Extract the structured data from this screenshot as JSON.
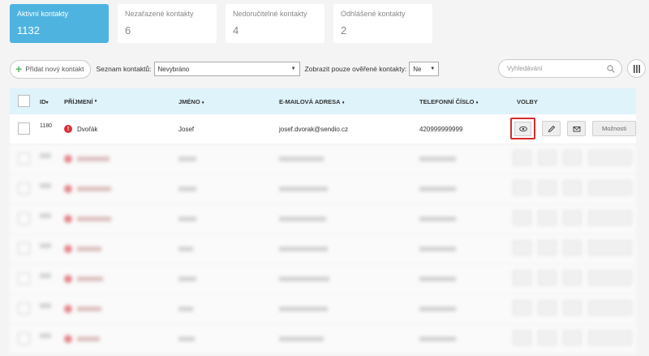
{
  "cards": [
    {
      "label": "Aktivní kontakty",
      "value": "1132",
      "active": true
    },
    {
      "label": "Nezařazené kontakty",
      "value": "6",
      "active": false
    },
    {
      "label": "Nedoručitelné kontakty",
      "value": "4",
      "active": false
    },
    {
      "label": "Odhlášené kontakty",
      "value": "2",
      "active": false
    }
  ],
  "toolbar": {
    "add_label": "Přidat nový kontakt",
    "list_label": "Seznam kontaktů:",
    "list_value": "Nevybráno",
    "verified_label": "Zobrazit pouze ověřené kontakty:",
    "verified_value": "Ne",
    "search_placeholder": "Vyhledávání"
  },
  "table": {
    "headers": {
      "id": "ID",
      "surname": "PŘÍJMENÍ",
      "name": "JMÉNO",
      "email": "E-MAILOVÁ ADRESA",
      "phone": "TELEFONNÍ ČÍSLO",
      "actions": "VOLBY"
    },
    "rows": [
      {
        "id": "1180",
        "surname": "Dvořák",
        "name": "Josef",
        "email": "josef.dvorak@sendio.cz",
        "phone": "420999999999",
        "more": "Možnosti"
      }
    ],
    "blurred_rows": [
      {
        "id": "",
        "surname": "",
        "name": "",
        "email": "",
        "phone": "",
        "more": ""
      },
      {
        "id": "",
        "surname": "",
        "name": "",
        "email": "",
        "phone": "",
        "more": ""
      },
      {
        "id": "",
        "surname": "",
        "name": "",
        "email": "",
        "phone": "",
        "more": ""
      },
      {
        "id": "",
        "surname": "",
        "name": "",
        "email": "",
        "phone": "",
        "more": ""
      },
      {
        "id": "",
        "surname": "",
        "name": "",
        "email": "",
        "phone": "",
        "more": ""
      },
      {
        "id": "",
        "surname": "",
        "name": "",
        "email": "",
        "phone": "",
        "more": ""
      },
      {
        "id": "",
        "surname": "",
        "name": "",
        "email": "",
        "phone": "",
        "more": ""
      }
    ]
  },
  "colors": {
    "accent": "#4fb3e0",
    "header_bg": "#dff3fb",
    "warn": "#d9303a",
    "highlight": "#d62b2b"
  }
}
